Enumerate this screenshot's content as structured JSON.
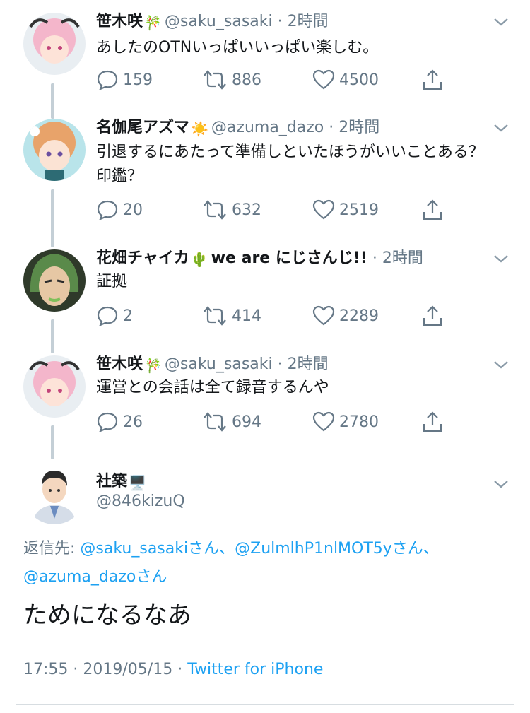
{
  "tweets": [
    {
      "name": "笹木咲",
      "emoji": "🎋",
      "handle": "@saku_sasaki",
      "sep": " · ",
      "time": "2時間",
      "text": "あしたのOTNいっぱいいっぱい楽しむ。",
      "replies": "159",
      "retweets": "886",
      "likes": "4500",
      "avatar_color": "#f3b3c9"
    },
    {
      "name": "名伽尾アズマ",
      "emoji": "☀️",
      "handle": "@azuma_dazo",
      "sep": " · ",
      "time": "2時間",
      "text": "引退するにあたって準備しといたほうがいいことある？印鑑？",
      "replies": "20",
      "retweets": "632",
      "likes": "2519",
      "avatar_color": "#e8a36a"
    },
    {
      "name": "花畑チャイカ",
      "emoji": "🌵",
      "name_suffix": "we are にじさんじ!!",
      "sep": " · ",
      "time": "2時間",
      "text": "証拠",
      "replies": "2",
      "retweets": "414",
      "likes": "2289",
      "avatar_color": "#5a8a4a"
    },
    {
      "name": "笹木咲",
      "emoji": "🎋",
      "handle": "@saku_sasaki",
      "sep": " · ",
      "time": "2時間",
      "text": "運営との会話は全て録音するんや",
      "replies": "26",
      "retweets": "694",
      "likes": "2780",
      "avatar_color": "#f3b3c9"
    }
  ],
  "main": {
    "name": "社築",
    "emoji": "🖥️",
    "handle": "@846kizuQ",
    "reply_label": "返信先: ",
    "mention1": "@saku_sasakiさん",
    "comma1": "、",
    "mention2": "@ZulmlhP1nlMOT5yさん",
    "comma2": "、",
    "mention3": "@azuma_dazoさん",
    "text": "ためになるなあ",
    "time": "17:55",
    "sep1": " · ",
    "date": "2019/05/15",
    "sep2": " · ",
    "source": "Twitter for iPhone"
  },
  "colors": {
    "accent": "#1da1f2",
    "secondary_text": "#657786",
    "thread_line": "#c4cfd6"
  }
}
